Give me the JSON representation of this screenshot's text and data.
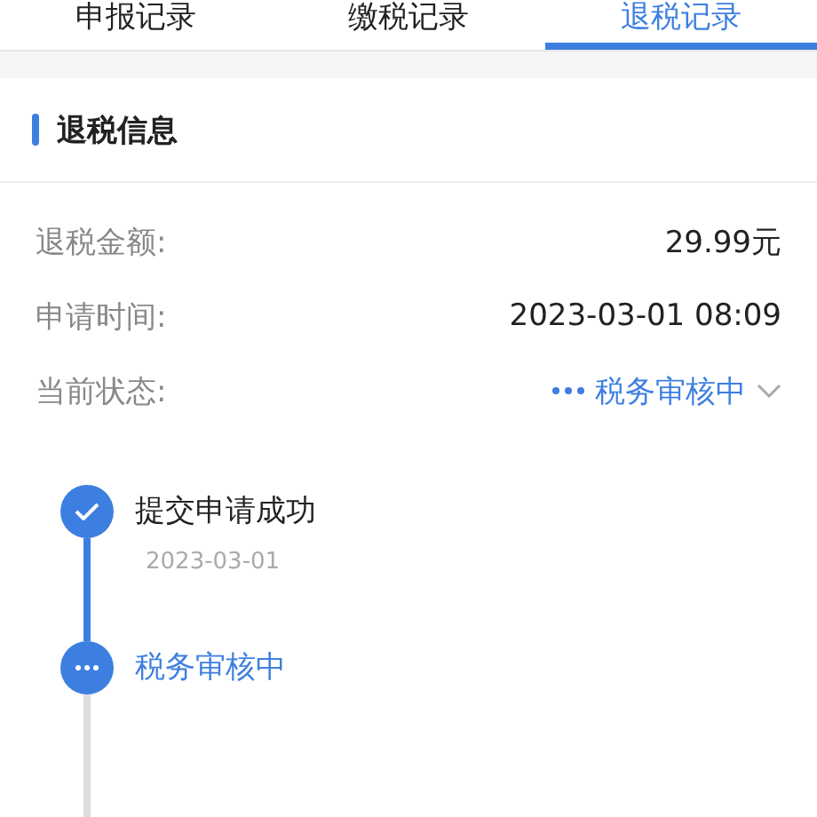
{
  "tabs": [
    {
      "label": "申报记录",
      "selected": false
    },
    {
      "label": "缴税记录",
      "selected": false
    },
    {
      "label": "退税记录",
      "selected": true
    }
  ],
  "section": {
    "title": "退税信息"
  },
  "fields": [
    {
      "label": "退税金额:",
      "value": "29.99元",
      "kind": "plain"
    },
    {
      "label": "申请时间:",
      "value": "2023-03-01 08:09",
      "kind": "plain"
    },
    {
      "label": "当前状态:",
      "value": "税务审核中",
      "kind": "status"
    }
  ],
  "steps": [
    {
      "title": "提交申请成功",
      "date": "2023-03-01",
      "kind": "done"
    },
    {
      "title": "税务审核中",
      "kind": "active"
    }
  ]
}
